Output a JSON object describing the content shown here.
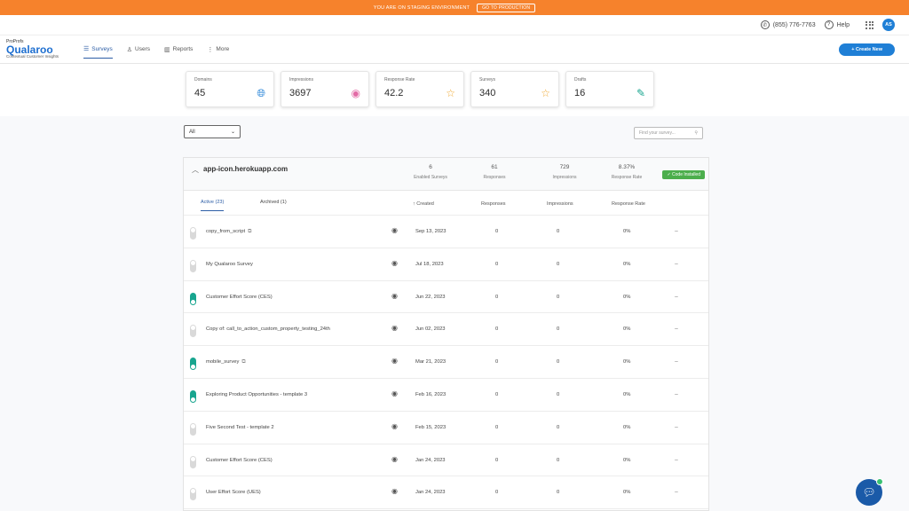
{
  "banner": {
    "text": "YOU ARE ON STAGING ENVIRONMENT",
    "button": "GO TO PRODUCTION"
  },
  "util": {
    "phone": "(855) 776-7763",
    "help": "Help",
    "avatar": "AS"
  },
  "logo": {
    "brand_small": "ProProfs",
    "brand": "Qualaroo",
    "tagline": "Contextual Customer Insights"
  },
  "nav": [
    {
      "label": "Surveys",
      "icon": "surveys-icon"
    },
    {
      "label": "Users",
      "icon": "user-icon"
    },
    {
      "label": "Reports",
      "icon": "chart-icon"
    },
    {
      "label": "More",
      "icon": "more-icon"
    }
  ],
  "create_button": "+ Create New",
  "stats": [
    {
      "label": "Domains",
      "value": "45",
      "icon": "globe-icon",
      "color": "#1f7fd6"
    },
    {
      "label": "Impressions",
      "value": "3697",
      "icon": "eye-icon",
      "color": "#e36ba6"
    },
    {
      "label": "Response Rate",
      "value": "42.2",
      "icon": "star-icon",
      "color": "#f0a830"
    },
    {
      "label": "Surveys",
      "value": "340",
      "icon": "star-icon",
      "color": "#f0a830"
    },
    {
      "label": "Drafts",
      "value": "16",
      "icon": "edit-icon",
      "color": "#18a58f"
    }
  ],
  "filter": {
    "selected": "All",
    "search_placeholder": "Find your survey..."
  },
  "domain_panel": {
    "domain": "app-icon.herokuapp.com",
    "metrics": [
      {
        "value": "6",
        "label": "Enabled Surveys"
      },
      {
        "value": "61",
        "label": "Responses"
      },
      {
        "value": "729",
        "label": "Impressions"
      },
      {
        "value": "8.37%",
        "label": "Response Rate"
      }
    ],
    "badge": "Code Installed"
  },
  "tabs": {
    "active": "Active (23)",
    "archived": "Archived (1)"
  },
  "columns": {
    "created": "Created",
    "responses": "Responses",
    "impressions": "Impressions",
    "rate": "Response Rate"
  },
  "rows": [
    {
      "name": "copy_from_script",
      "dup": true,
      "on": false,
      "created": "Sep 13, 2023",
      "responses": "0",
      "impressions": "0",
      "rate": "0%",
      "extra": "--"
    },
    {
      "name": "My Qualaroo Survey",
      "dup": false,
      "on": false,
      "created": "Jul 18, 2023",
      "responses": "0",
      "impressions": "0",
      "rate": "0%",
      "extra": "--"
    },
    {
      "name": "Customer Effort Score (CES)",
      "dup": false,
      "on": true,
      "created": "Jun 22, 2023",
      "responses": "0",
      "impressions": "0",
      "rate": "0%",
      "extra": "--"
    },
    {
      "name": "Copy of: call_to_action_custom_property_testing_24th",
      "dup": false,
      "on": false,
      "created": "Jun 02, 2023",
      "responses": "0",
      "impressions": "0",
      "rate": "0%",
      "extra": "--"
    },
    {
      "name": "mobile_survey",
      "dup": true,
      "on": true,
      "created": "Mar 21, 2023",
      "responses": "0",
      "impressions": "0",
      "rate": "0%",
      "extra": "--"
    },
    {
      "name": "Exploring Product Opportunities - template 3",
      "dup": false,
      "on": true,
      "created": "Feb 16, 2023",
      "responses": "0",
      "impressions": "0",
      "rate": "0%",
      "extra": "--"
    },
    {
      "name": "Five Second Test - template 2",
      "dup": false,
      "on": false,
      "created": "Feb 15, 2023",
      "responses": "0",
      "impressions": "0",
      "rate": "0%",
      "extra": "--"
    },
    {
      "name": "Customer Effort Score (CES)",
      "dup": false,
      "on": false,
      "created": "Jan 24, 2023",
      "responses": "0",
      "impressions": "0",
      "rate": "0%",
      "extra": "--"
    },
    {
      "name": "User Effort Score (UES)",
      "dup": false,
      "on": false,
      "created": "Jan 24, 2023",
      "responses": "0",
      "impressions": "0",
      "rate": "0%",
      "extra": "--"
    }
  ]
}
